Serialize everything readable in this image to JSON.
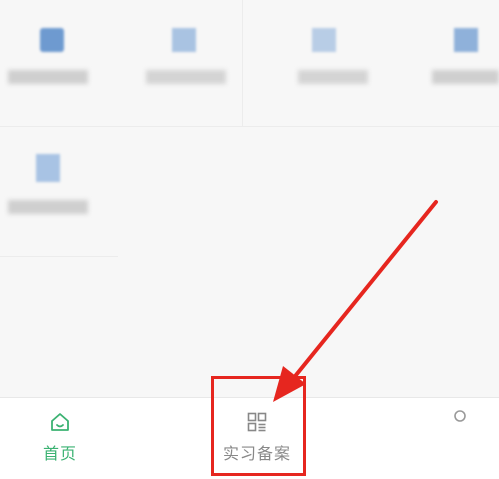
{
  "tabbar": {
    "tabs": [
      {
        "label": "首页",
        "icon": "home-icon",
        "active": true
      },
      {
        "label": "实习备案",
        "icon": "grid-icon",
        "active": false
      }
    ],
    "active_color": "#3bb272",
    "inactive_color": "#888888"
  },
  "annotation": {
    "color": "#e6261f"
  }
}
